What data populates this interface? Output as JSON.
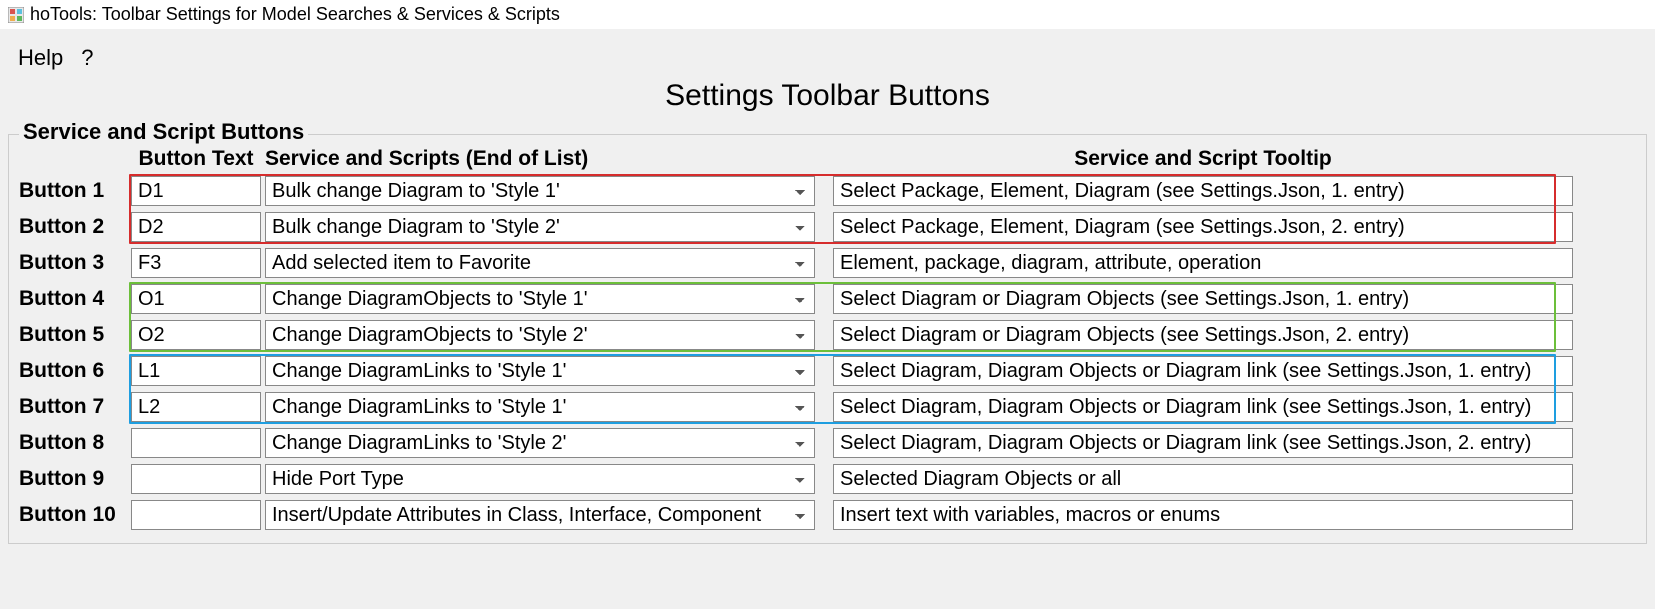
{
  "window": {
    "title": "hoTools: Toolbar Settings for Model Searches & Services & Scripts"
  },
  "menu": {
    "help": "Help",
    "qmark": "?"
  },
  "heading": "Settings Toolbar  Buttons",
  "group": {
    "legend": "Service and Script Buttons",
    "headers": {
      "buttonText": "Button Text",
      "service": "Service and Scripts (End of List)",
      "tooltip": "Service and Script Tooltip"
    },
    "rows": [
      {
        "label": "Button 1",
        "text": "D1",
        "service": "Bulk change Diagram to 'Style 1'",
        "tooltip": "Select Package, Element, Diagram (see Settings.Json, 1. entry)"
      },
      {
        "label": "Button 2",
        "text": "D2",
        "service": "Bulk change Diagram to 'Style 2'",
        "tooltip": "Select Package, Element, Diagram (see Settings.Json, 2. entry)"
      },
      {
        "label": "Button 3",
        "text": "F3",
        "service": "Add selected item to Favorite",
        "tooltip": "Element, package, diagram, attribute, operation"
      },
      {
        "label": "Button 4",
        "text": "O1",
        "service": "Change DiagramObjects to 'Style 1'",
        "tooltip": "Select Diagram or Diagram Objects (see Settings.Json, 1. entry)"
      },
      {
        "label": "Button 5",
        "text": "O2",
        "service": "Change DiagramObjects to 'Style 2'",
        "tooltip": "Select Diagram or Diagram Objects (see Settings.Json, 2. entry)"
      },
      {
        "label": "Button 6",
        "text": "L1",
        "service": "Change DiagramLinks to 'Style 1'",
        "tooltip": "Select Diagram, Diagram Objects or Diagram link (see Settings.Json, 1. entry)"
      },
      {
        "label": "Button 7",
        "text": "L2",
        "service": "Change DiagramLinks to 'Style 1'",
        "tooltip": "Select Diagram, Diagram Objects or Diagram link (see Settings.Json, 1. entry)"
      },
      {
        "label": "Button 8",
        "text": "",
        "service": "Change DiagramLinks to 'Style 2'",
        "tooltip": "Select Diagram, Diagram Objects or Diagram link (see Settings.Json, 2. entry)"
      },
      {
        "label": "Button 9",
        "text": "",
        "service": "Hide Port Type",
        "tooltip": "Selected Diagram Objects or all"
      },
      {
        "label": "Button 10",
        "text": "",
        "service": "Insert/Update Attributes in Class, Interface, Component",
        "tooltip": "Insert text with variables, macros or enums"
      }
    ]
  },
  "highlights": {
    "red": {
      "color": "#d62c2c"
    },
    "green": {
      "color": "#6cbf3a"
    },
    "blue": {
      "color": "#1e9ee0"
    }
  }
}
